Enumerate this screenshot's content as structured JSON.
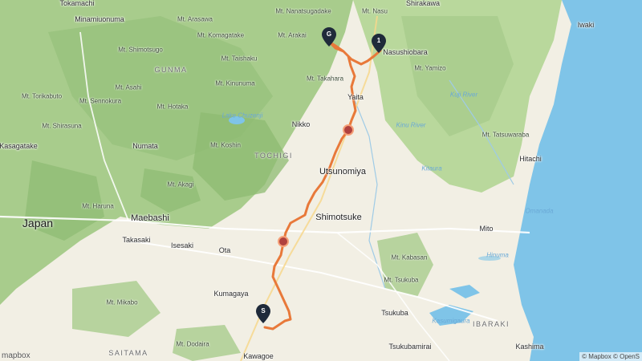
{
  "map": {
    "colors": {
      "land": "#f2efe4",
      "forest": "#a8cc8c",
      "forest_dark": "#7fb56a",
      "sea": "#7fc4e8",
      "route": "#e8793a",
      "marker": "#1f2a3a"
    },
    "country_label": "Japan",
    "region_labels": [
      "GUNMA",
      "TOCHIGI",
      "IBARAKI",
      "SAITAMA"
    ],
    "city_labels": [
      "Tokamachi",
      "Minamiuonuma",
      "Shirakawa",
      "Iwaki",
      "Numata",
      "Nikko",
      "Yaita",
      "Utsunomiya",
      "Shimotsuke",
      "Maebashi",
      "Takasaki",
      "Isesaki",
      "Ota",
      "Kumagaya",
      "Tsukuba",
      "Tsukubamirai",
      "Kawagoe",
      "Mito",
      "Hitachi",
      "Kashima",
      "Nasushiobara",
      "Kasagatake"
    ],
    "peak_labels": [
      "Mt. Nasu",
      "Mt. Nanatsugadake",
      "Mt. Arasawa",
      "Mt. Komagatake",
      "Mt. Arakai",
      "Mt. Shimotsugo",
      "Mt. Taishaku",
      "Mt. Takahara",
      "Mt. Kinunuma",
      "Mt. Asahi",
      "Mt. Torikabuto",
      "Mt. Sennokura",
      "Mt. Hotaka",
      "Mt. Shirasuna",
      "Mt. Koshin",
      "Mt. Akagi",
      "Mt. Haruna",
      "Mt. Yamizo",
      "Mt. Tatsuwaraba",
      "Mt. Kabasan",
      "Mt. Tsukuba",
      "Mt. Mikabo",
      "Mt. Dodaira"
    ],
    "water_labels": [
      "Lake Chuzenji",
      "Kuji River",
      "Kinu River",
      "Hinuma",
      "Kitaura",
      "Kasumigaura",
      "Omanada"
    ],
    "markers": [
      {
        "id": "start",
        "label": "S"
      },
      {
        "id": "stop-1",
        "label": "1"
      },
      {
        "id": "goal",
        "label": "G"
      }
    ],
    "attribution": "© Mapbox © OpenS",
    "logo": "mapbox"
  }
}
